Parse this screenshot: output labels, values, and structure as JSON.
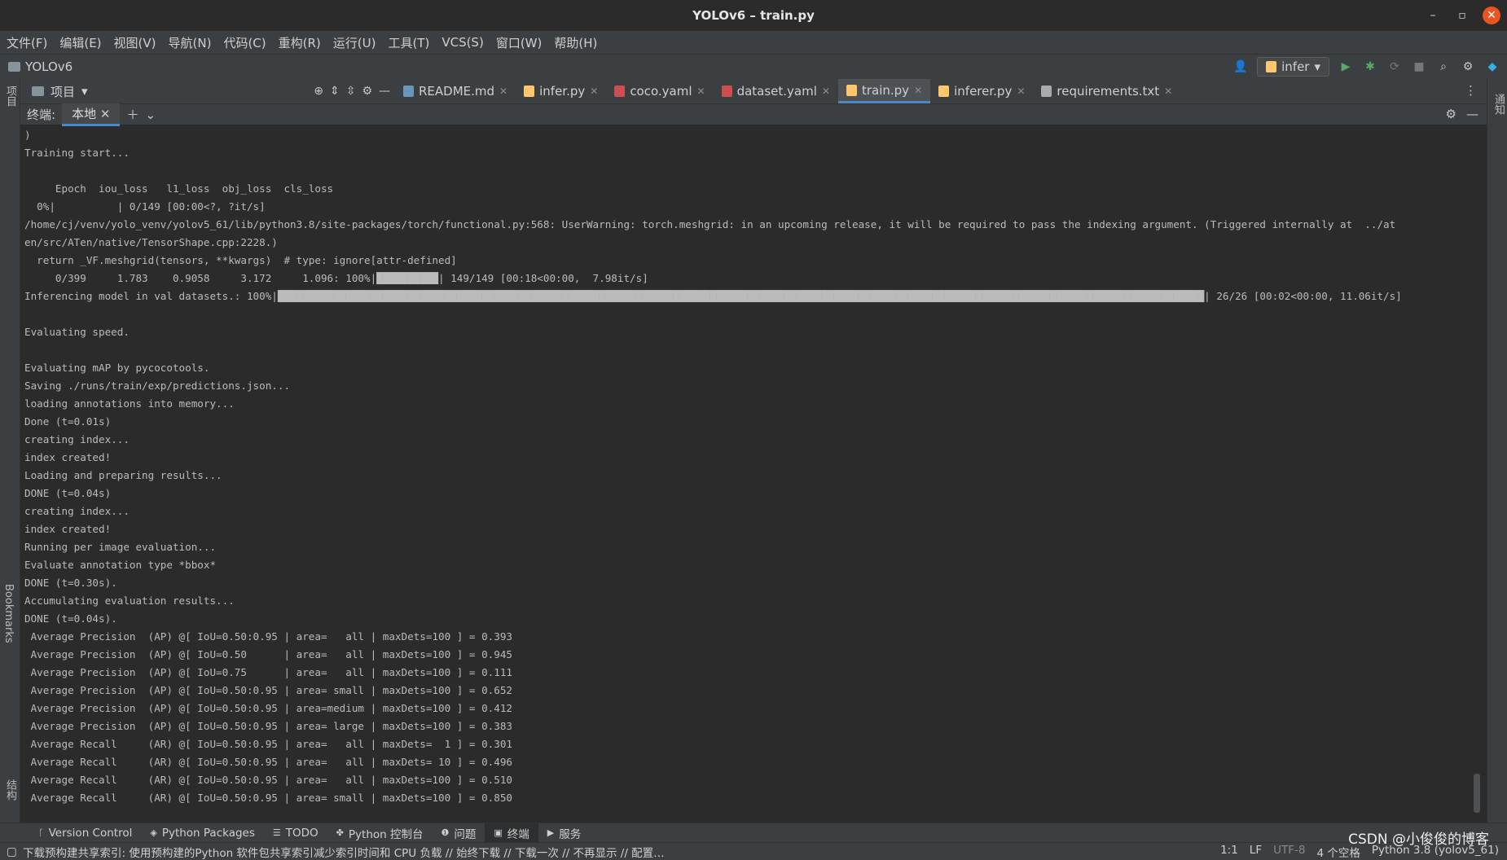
{
  "window": {
    "title": "YOLOv6 – train.py",
    "minimize": "–",
    "maximize": "▫",
    "close": "✕"
  },
  "menu": [
    "文件(F)",
    "编辑(E)",
    "视图(V)",
    "导航(N)",
    "代码(C)",
    "重构(R)",
    "运行(U)",
    "工具(T)",
    "VCS(S)",
    "窗口(W)",
    "帮助(H)"
  ],
  "nav": {
    "project": "YOLOv6",
    "run_config": "infer"
  },
  "left_strip": {
    "top": "项目",
    "bookmarks": "Bookmarks",
    "structure": "结构"
  },
  "right_strip": {
    "notifications": "通知"
  },
  "project_tool": {
    "label": "项目"
  },
  "tabs": [
    {
      "name": "README.md",
      "icon_color": "#6897bb"
    },
    {
      "name": "infer.py",
      "icon_color": "#ffc66d"
    },
    {
      "name": "coco.yaml",
      "icon_color": "#cc4e4e"
    },
    {
      "name": "dataset.yaml",
      "icon_color": "#cc4e4e"
    },
    {
      "name": "train.py",
      "icon_color": "#ffc66d"
    },
    {
      "name": "inferer.py",
      "icon_color": "#ffc66d"
    },
    {
      "name": "requirements.txt",
      "icon_color": "#aaaaaa"
    }
  ],
  "terminal": {
    "header": "终端:",
    "tab": "本地",
    "lines": [
      ")",
      "Training start...",
      "",
      "     Epoch  iou_loss   l1_loss  obj_loss  cls_loss",
      "  0%|          | 0/149 [00:00<?, ?it/s]",
      "/home/cj/venv/yolo_venv/yolov5_61/lib/python3.8/site-packages/torch/functional.py:568: UserWarning: torch.meshgrid: in an upcoming release, it will be required to pass the indexing argument. (Triggered internally at  ../at",
      "en/src/ATen/native/TensorShape.cpp:2228.)",
      "  return _VF.meshgrid(tensors, **kwargs)  # type: ignore[attr-defined]",
      "     0/399     1.783    0.9058     3.172     1.096: 100%|██████████| 149/149 [00:18<00:00,  7.98it/s]",
      "Inferencing model in val datasets.: 100%|██████████████████████████████████████████████████████████████████████████████████████████████████████████████████████████████████████████████████████| 26/26 [00:02<00:00, 11.06it/s]",
      "",
      "Evaluating speed.",
      "",
      "Evaluating mAP by pycocotools.",
      "Saving ./runs/train/exp/predictions.json...",
      "loading annotations into memory...",
      "Done (t=0.01s)",
      "creating index...",
      "index created!",
      "Loading and preparing results...",
      "DONE (t=0.04s)",
      "creating index...",
      "index created!",
      "Running per image evaluation...",
      "Evaluate annotation type *bbox*",
      "DONE (t=0.30s).",
      "Accumulating evaluation results...",
      "DONE (t=0.04s).",
      " Average Precision  (AP) @[ IoU=0.50:0.95 | area=   all | maxDets=100 ] = 0.393",
      " Average Precision  (AP) @[ IoU=0.50      | area=   all | maxDets=100 ] = 0.945",
      " Average Precision  (AP) @[ IoU=0.75      | area=   all | maxDets=100 ] = 0.111",
      " Average Precision  (AP) @[ IoU=0.50:0.95 | area= small | maxDets=100 ] = 0.652",
      " Average Precision  (AP) @[ IoU=0.50:0.95 | area=medium | maxDets=100 ] = 0.412",
      " Average Precision  (AP) @[ IoU=0.50:0.95 | area= large | maxDets=100 ] = 0.383",
      " Average Recall     (AR) @[ IoU=0.50:0.95 | area=   all | maxDets=  1 ] = 0.301",
      " Average Recall     (AR) @[ IoU=0.50:0.95 | area=   all | maxDets= 10 ] = 0.496",
      " Average Recall     (AR) @[ IoU=0.50:0.95 | area=   all | maxDets=100 ] = 0.510",
      " Average Recall     (AR) @[ IoU=0.50:0.95 | area= small | maxDets=100 ] = 0.850"
    ]
  },
  "bottom_tools": [
    {
      "label": "Version Control",
      "icon": "branch-icon",
      "glyph": "ᚴ"
    },
    {
      "label": "Python Packages",
      "icon": "packages-icon",
      "glyph": "◈"
    },
    {
      "label": "TODO",
      "icon": "list-icon",
      "glyph": "☰"
    },
    {
      "label": "Python 控制台",
      "icon": "python-icon",
      "glyph": "✤"
    },
    {
      "label": "问题",
      "icon": "info-icon",
      "glyph": "❶"
    },
    {
      "label": "终端",
      "icon": "terminal-icon",
      "glyph": "▣",
      "active": true
    },
    {
      "label": "服务",
      "icon": "play-circle-icon",
      "glyph": "▶"
    }
  ],
  "status": {
    "message": "下载预构建共享索引: 使用预构建的Python 软件包共享索引减少索引时间和 CPU 负载 // 始终下载 // 下载一次 // 不再显示 // 配置…",
    "position": "1:1",
    "line_sep": "LF",
    "encoding": "UTF-8",
    "indent": "4 个空格",
    "interpreter": "Python 3.8 (yolov5_61)"
  },
  "watermark": "CSDN @小俊俊的博客"
}
